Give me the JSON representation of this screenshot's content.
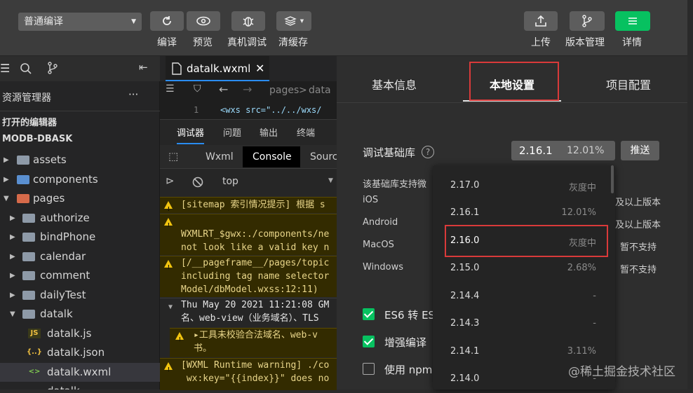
{
  "toolbar": {
    "compile_mode": "普通编译",
    "buttons": {
      "compile": "编译",
      "preview": "预览",
      "remote_debug": "真机调试",
      "clear_cache": "清缓存",
      "upload": "上传",
      "version": "版本管理",
      "details": "详情"
    }
  },
  "sidebar": {
    "title": "资源管理器",
    "more": "···",
    "open_editors": "打开的编辑器",
    "project": "MODB-DBASK",
    "tree": [
      {
        "label": "assets"
      },
      {
        "label": "components"
      },
      {
        "label": "pages"
      },
      {
        "label": "authorize"
      },
      {
        "label": "bindPhone"
      },
      {
        "label": "calendar"
      },
      {
        "label": "comment"
      },
      {
        "label": "dailyTest"
      },
      {
        "label": "datalk"
      },
      {
        "label": "datalk.js",
        "tag": "JS"
      },
      {
        "label": "datalk.json",
        "tag": "{..}"
      },
      {
        "label": "datalk.wxml",
        "tag": "<>"
      },
      {
        "label": "datalk..."
      }
    ]
  },
  "editor": {
    "tab": "datalk.wxml",
    "breadcrumb_1": "pages",
    "breadcrumb_2": "data",
    "line_no": "1",
    "code_line": "<wxs src=\"../../wxs/"
  },
  "debugger": {
    "tabs": [
      "调试器",
      "问题",
      "输出",
      "终端"
    ],
    "subtabs": [
      "Wxml",
      "Console",
      "Sourc"
    ],
    "context": "top",
    "lines": [
      "[sitemap 索引情况提示] 根据 s",
      "\nWXMLRT_$gwx:./components/ne\nnot look like a valid key n",
      "[/__pageframe__/pages/topic\nincluding tag name selector\nModel/dbModel.wxss:12:11)",
      "Thu May 20 2021 11:21:08 GM\n名、web-view（业务域名）、TLS",
      "▸工具未校验合法域名、web-v\n书。",
      "[WXML Runtime warning] ./co\n wx:key=\"{{index}}\" does no"
    ]
  },
  "settings": {
    "tabs": [
      "基本信息",
      "本地设置",
      "项目配置"
    ],
    "lib_label": "调试基础库",
    "lib_value": "2.16.1",
    "lib_pct": "12.01%",
    "push_button": "推送",
    "support_note": "该基础库支持微",
    "platforms": [
      {
        "name": "iOS",
        "value": "及以上版本"
      },
      {
        "name": "Android",
        "value": "及以上版本"
      },
      {
        "name": "MacOS",
        "value": "暂不支持"
      },
      {
        "name": "Windows",
        "value": "暂不支持"
      }
    ],
    "checkboxes": [
      {
        "label": "ES6 转 ES",
        "checked": true
      },
      {
        "label": "增强编译",
        "checked": true
      },
      {
        "label": "使用 npm",
        "checked": false
      }
    ],
    "dropdown": [
      {
        "version": "2.17.0",
        "status": "灰度中"
      },
      {
        "version": "2.16.1",
        "status": "12.01%"
      },
      {
        "version": "2.16.0",
        "status": "灰度中"
      },
      {
        "version": "2.15.0",
        "status": "2.68%"
      },
      {
        "version": "2.14.4",
        "status": "-"
      },
      {
        "version": "2.14.3",
        "status": "-"
      },
      {
        "version": "2.14.1",
        "status": "3.11%"
      },
      {
        "version": "2.14.0",
        "status": "-"
      }
    ]
  },
  "watermark": "@稀土掘金技术社区",
  "colors": {
    "accent_green": "#07c160",
    "highlight_red": "#d93a3a",
    "tab_blue": "#2a8cf0"
  }
}
